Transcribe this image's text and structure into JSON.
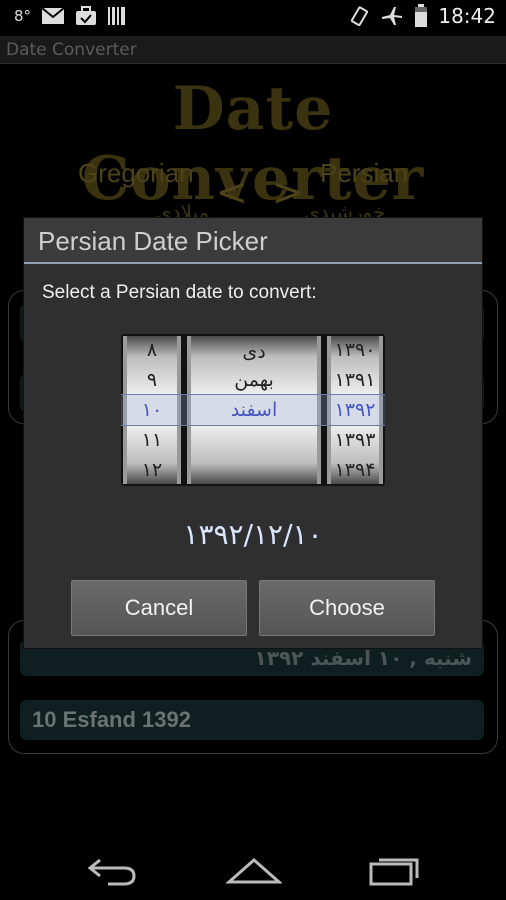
{
  "status_bar": {
    "temperature": "8°",
    "time": "18:42",
    "left_icons": [
      "gmail-icon",
      "briefcase-check-icon",
      "barcode-icon"
    ],
    "right_icons": [
      "vibrate-icon",
      "airplane-mode-icon",
      "battery-icon"
    ]
  },
  "action_bar": {
    "title": "Date Converter"
  },
  "background": {
    "logo_text": "Date Converter",
    "gregorian_label": "Gregorian",
    "persian_label": "Persian",
    "arrows": "< >",
    "gregorian_label_fa": "میلادی",
    "persian_label_fa": "خورشیدی",
    "result_persian": "شنبه , ۱۰ اسفند ۱۳۹۲",
    "result_english": "10 Esfand 1392"
  },
  "dialog": {
    "title": "Persian Date Picker",
    "message": "Select a Persian date to convert:",
    "picker": {
      "days": [
        "۸",
        "۹",
        "۱۰",
        "۱۱",
        "۱۲"
      ],
      "months": [
        "دی",
        "بهمن",
        "اسفند",
        ""
      ],
      "years": [
        "۱۳۹۰",
        "۱۳۹۱",
        "۱۳۹۲",
        "۱۳۹۳",
        "۱۳۹۴"
      ],
      "selected_day": "۱۰",
      "selected_month": "اسفند",
      "selected_year": "۱۳۹۲"
    },
    "result_date": "۱۳۹۲/۱۲/۱۰",
    "cancel_label": "Cancel",
    "choose_label": "Choose"
  },
  "nav_bar": {
    "icons": [
      "back-icon",
      "home-icon",
      "recent-apps-icon"
    ]
  },
  "colors": {
    "selection_text": "#2735b8",
    "title_divider": "#8fa0b0",
    "logo_gold": "#3b3310"
  }
}
